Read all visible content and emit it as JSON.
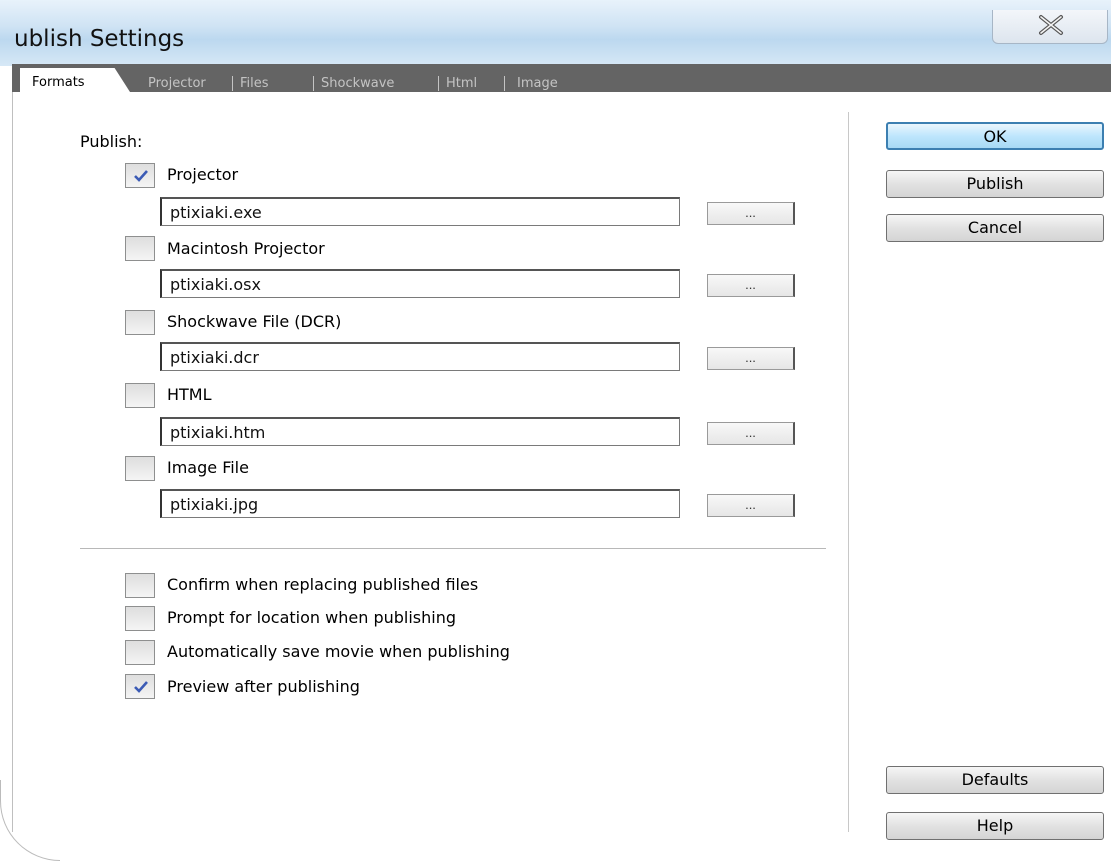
{
  "window": {
    "title": "ublish Settings"
  },
  "tabs": [
    "Formats",
    "Projector",
    "Files",
    "Shockwave",
    "Html",
    "Image"
  ],
  "publish": {
    "label": "Publish:",
    "formats": [
      {
        "label": "Projector",
        "checked": true,
        "file": "ptixiaki.exe",
        "browse": "..."
      },
      {
        "label": "Macintosh Projector",
        "checked": false,
        "file": "ptixiaki.osx",
        "browse": "..."
      },
      {
        "label": "Shockwave File (DCR)",
        "checked": false,
        "file": "ptixiaki.dcr",
        "browse": "..."
      },
      {
        "label": "HTML",
        "checked": false,
        "file": "ptixiaki.htm",
        "browse": "..."
      },
      {
        "label": "Image File",
        "checked": false,
        "file": "ptixiaki.jpg",
        "browse": "..."
      }
    ]
  },
  "options": [
    {
      "label": "Confirm when replacing published files",
      "checked": false
    },
    {
      "label": "Prompt for location when publishing",
      "checked": false
    },
    {
      "label": "Automatically save movie when publishing",
      "checked": false
    },
    {
      "label": "Preview after publishing",
      "checked": true
    }
  ],
  "buttons": {
    "ok": "OK",
    "publish": "Publish",
    "cancel": "Cancel",
    "defaults": "Defaults",
    "help": "Help"
  },
  "colors": {
    "accent": "#3c7fb1",
    "check": "#3b5bb5",
    "tab_strip": "#646464"
  }
}
